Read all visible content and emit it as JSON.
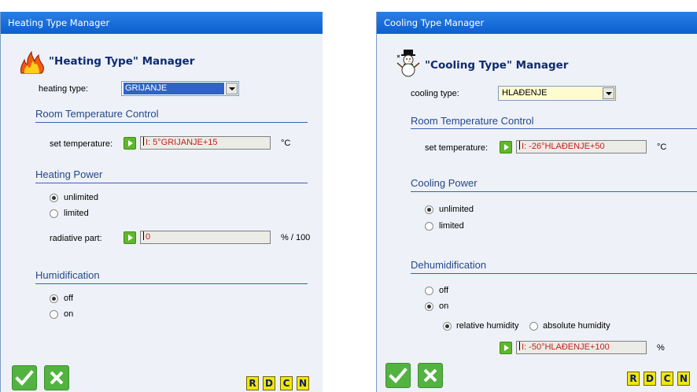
{
  "heating": {
    "title": "Heating Type Manager",
    "header": "\"Heating Type\" Manager",
    "type_label": "heating type:",
    "type_value": "GRIJANJE",
    "room_section": "Room Temperature Control",
    "set_temp_label": "set temperature:",
    "set_temp_value": "I: 5°GRIJANJE+15",
    "set_temp_unit": "°C",
    "power_section": "Heating Power",
    "opt_unlimited": "unlimited",
    "opt_limited": "limited",
    "power_selected": "unlimited",
    "radiative_label": "radiative part:",
    "radiative_value": "0",
    "radiative_unit": "% / 100",
    "humid_section": "Humidification",
    "opt_off": "off",
    "opt_on": "on",
    "humid_selected": "off"
  },
  "cooling": {
    "title": "Cooling Type Manager",
    "header": "\"Cooling Type\" Manager",
    "type_label": "cooling type:",
    "type_value": "HLAĐENJE",
    "room_section": "Room Temperature Control",
    "set_temp_label": "set temperature:",
    "set_temp_value": "I: -26°HLAĐENJE+50",
    "set_temp_unit": "°C",
    "power_section": "Cooling Power",
    "opt_unlimited": "unlimited",
    "opt_limited": "limited",
    "power_selected": "unlimited",
    "dehumid_section": "Dehumidification",
    "opt_off": "off",
    "opt_on": "on",
    "dehumid_selected": "on",
    "opt_relative": "relative humidity",
    "opt_absolute": "absolute humidity",
    "humidity_mode_selected": "relative humidity",
    "humidity_value": "I: -50°HLAĐENJE+100",
    "humidity_unit": "%"
  },
  "footer": {
    "r_label": "R",
    "d_label": "D",
    "c_label": "C",
    "n_label": "N"
  },
  "colors": {
    "title_bar": "#0b5fd0",
    "section_title": "#24488c",
    "field_text": "#c02020",
    "ok_green": "#52b340",
    "footer_button": "#f2e60c",
    "selected_item": "#3163c5",
    "cooling_combo_bg": "#fffbd0"
  }
}
